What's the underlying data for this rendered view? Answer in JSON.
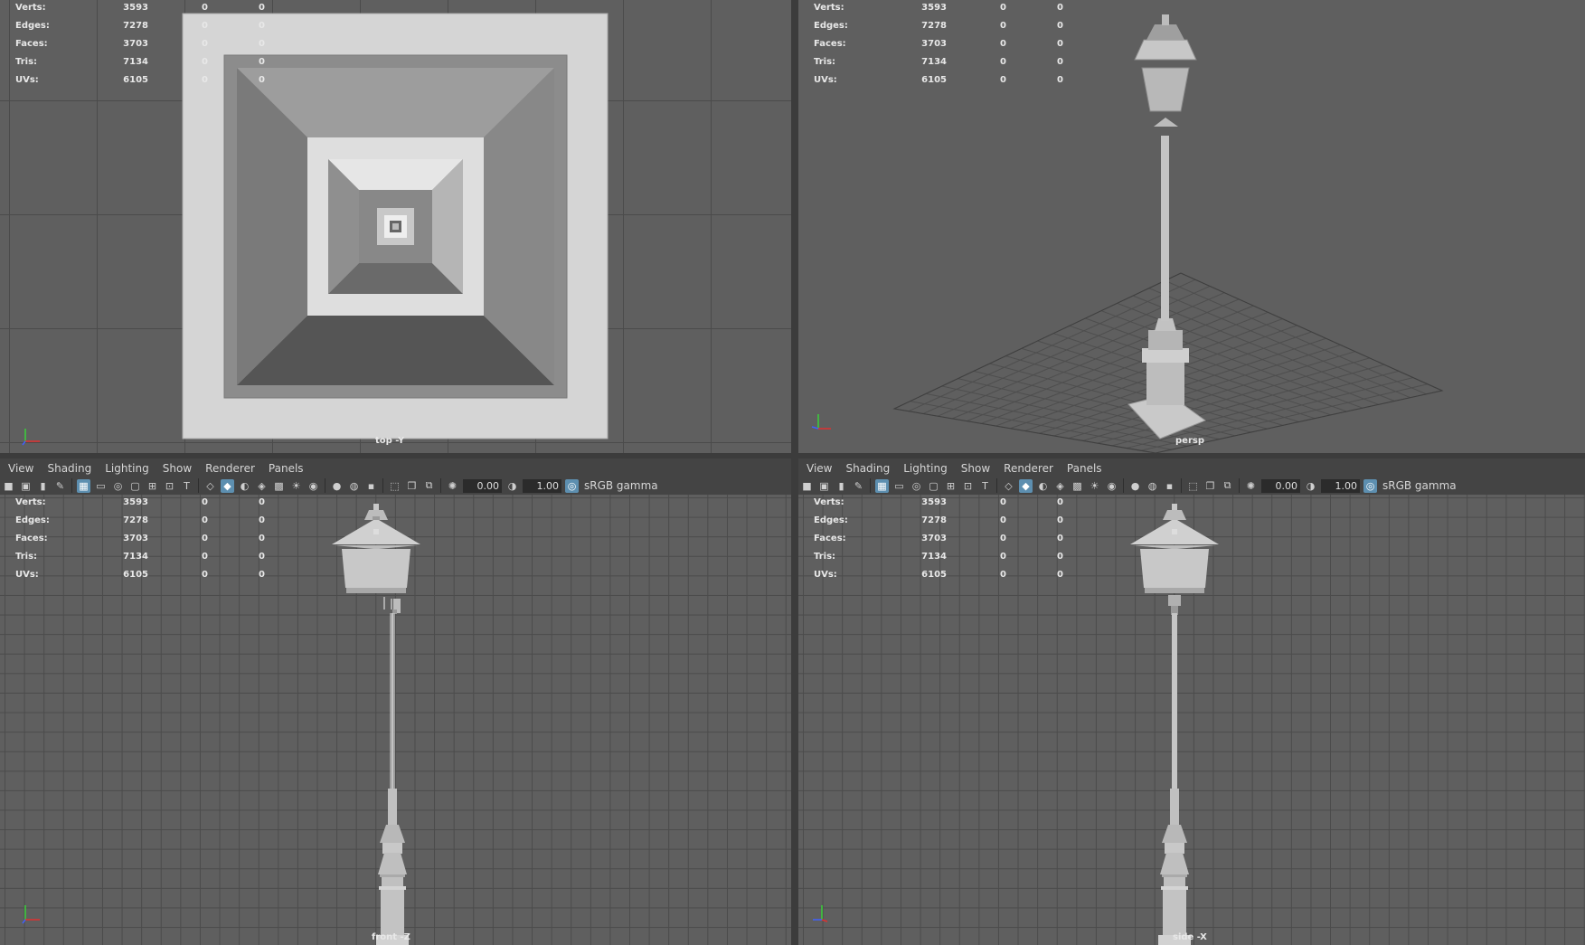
{
  "stats": {
    "rows": [
      {
        "label": "Verts:",
        "v1": "3593",
        "v2": "0",
        "v3": "0"
      },
      {
        "label": "Edges:",
        "v1": "7278",
        "v2": "0",
        "v3": "0"
      },
      {
        "label": "Faces:",
        "v1": "3703",
        "v2": "0",
        "v3": "0"
      },
      {
        "label": "Tris:",
        "v1": "7134",
        "v2": "0",
        "v3": "0"
      },
      {
        "label": "UVs:",
        "v1": "6105",
        "v2": "0",
        "v3": "0"
      }
    ]
  },
  "viewports": {
    "top": {
      "camera": "top -Y"
    },
    "persp": {
      "camera": "persp"
    },
    "front": {
      "camera": "front -Z"
    },
    "side": {
      "camera": "side -X"
    }
  },
  "panel_menu": {
    "view": "View",
    "shading": "Shading",
    "lighting": "Lighting",
    "show": "Show",
    "renderer": "Renderer",
    "panels": "Panels"
  },
  "panel_toolbar": {
    "exposure": "0.00",
    "gamma": "1.00",
    "color_space": "sRGB gamma"
  },
  "colors": {
    "viewport_bg": "#5f5f5f",
    "grid_line": "#4b4b4b",
    "active_icon": "#5d8fb0"
  }
}
